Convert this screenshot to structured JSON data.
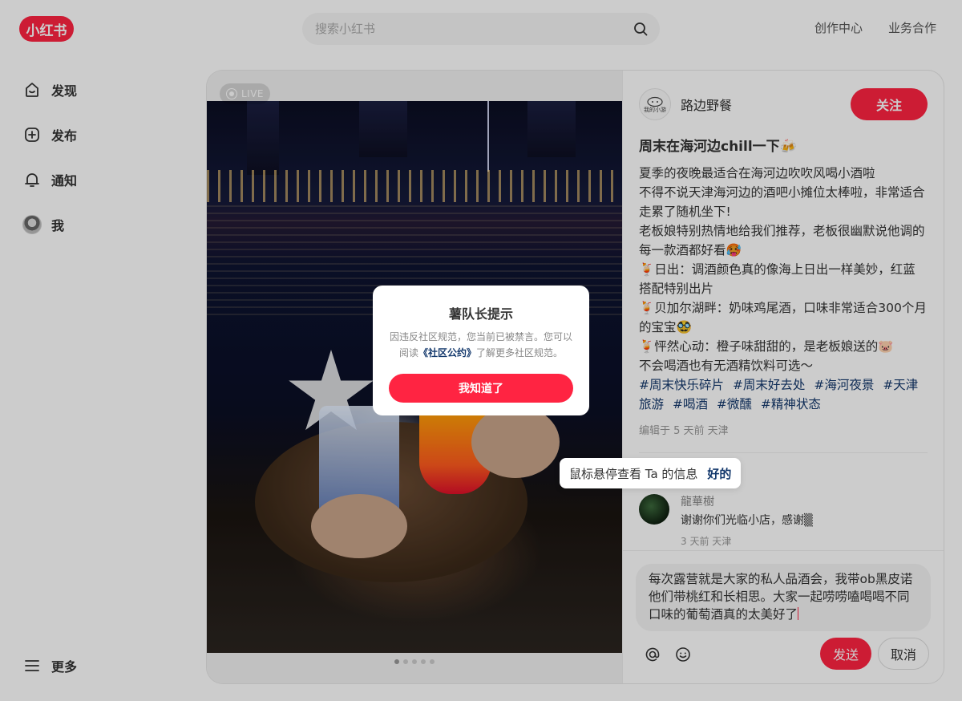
{
  "header": {
    "logo": "小红书",
    "search_placeholder": "搜索小红书",
    "links": [
      "创作中心",
      "业务合作"
    ]
  },
  "sidebar": {
    "items": [
      {
        "label": "发现",
        "icon": "home-icon"
      },
      {
        "label": "发布",
        "icon": "plus-square-icon"
      },
      {
        "label": "通知",
        "icon": "bell-icon"
      },
      {
        "label": "我",
        "icon": "avatar"
      }
    ],
    "more": {
      "label": "更多",
      "icon": "menu-icon"
    }
  },
  "note": {
    "live_label": "LIVE",
    "author": {
      "name": "路边野餐",
      "avatar_text": "我的小游"
    },
    "follow_label": "关注",
    "title": "周末在海河边chill一下🍻",
    "desc_lines": [
      "夏季的夜晚最适合在海河边吹吹风喝小酒啦",
      "不得不说天津海河边的酒吧小摊位太棒啦，非常适合走累了随机坐下!",
      "老板娘特别热情地给我们推荐，老板很幽默说他调的每一款酒都好看🥵",
      "🍹日出：调酒颜色真的像海上日出一样美妙，红蓝搭配特别出片",
      "🍹贝加尔湖畔：奶味鸡尾酒，口味非常适合300个月的宝宝🥸",
      "🍹怦然心动：橙子味甜甜的，是老板娘送的🐷",
      "不会喝酒也有无酒精饮料可选～"
    ],
    "tags": [
      "#周末快乐碎片",
      "#周末好去处",
      "#海河夜景",
      "#天津旅游",
      "#喝酒",
      "#微醺",
      "#精神状态"
    ],
    "meta": "编辑于 5 天前 天津",
    "image_count": 5,
    "current_image": 1
  },
  "comment": {
    "name": "龍華樹",
    "text": "谢谢你们光临小店，感谢▒",
    "meta": "3 天前 天津"
  },
  "composer": {
    "text": "每次露营就是大家的私人品酒会，我带ob黑皮诺他们带桃红和长相思。大家一起唠唠嗑喝喝不同口味的葡萄酒真的太美好了",
    "send_label": "发送",
    "cancel_label": "取消"
  },
  "tooltip": {
    "text": "鼠标悬停查看 Ta 的信息",
    "ok_label": "好的"
  },
  "dialog": {
    "title": "薯队长提示",
    "text_before": "因违反社区规范，您当前已被禁言。您可以阅读",
    "link": "《社区公约》",
    "text_after": "了解更多社区规范。",
    "button": "我知道了"
  },
  "colors": {
    "brand": "#ff2442",
    "tag": "#13386c"
  }
}
